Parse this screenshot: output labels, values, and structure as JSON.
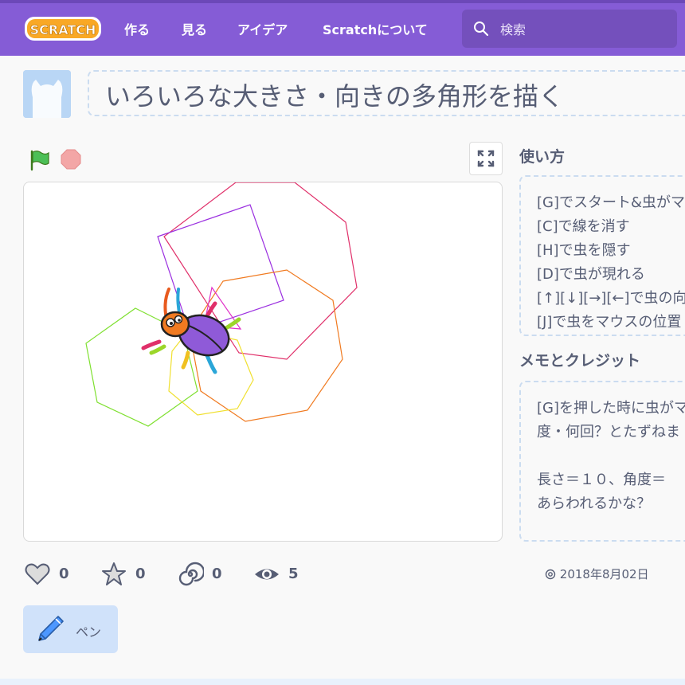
{
  "nav": {
    "logo_text": "SCRATCH",
    "items": [
      "作る",
      "見る",
      "アイデア",
      "Scratchについて"
    ],
    "search_placeholder": "検索"
  },
  "project": {
    "title": "いろいろな大きさ・向きの多角形を描く"
  },
  "instructions": {
    "heading": "使い方",
    "lines": [
      "[G]でスタート&虫がマ",
      "[C]で線を消す",
      "[H]で虫を隠す",
      "[D]で虫が現れる",
      "[↑][↓][→][←]で虫の向",
      "[J]で虫をマウスの位置"
    ]
  },
  "notes": {
    "heading": "メモとクレジット",
    "lines": [
      "[G]を押した時に虫がマ",
      "度・何回？とたずねま",
      "",
      "長さ＝１０、角度＝",
      "あらわれるかな？"
    ]
  },
  "stats": {
    "loves": "0",
    "favorites": "0",
    "remixes": "0",
    "views": "5"
  },
  "shared_date": "2018年8月02日",
  "extension": {
    "label": "ペン"
  },
  "colors": {
    "navbar": "#855cd6",
    "text": "#575e75",
    "dashed_border": "#cbdcf0",
    "extension_bg": "#d0e2fa"
  }
}
